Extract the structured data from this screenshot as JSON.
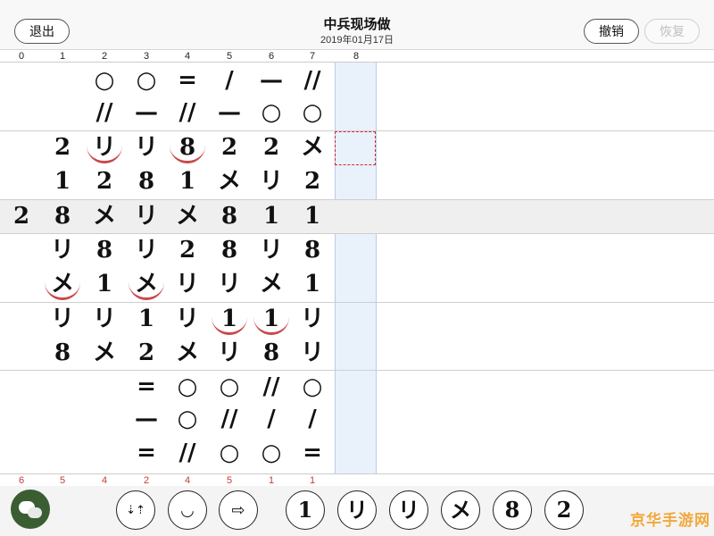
{
  "header": {
    "exit_label": "退出",
    "title": "中兵现场做",
    "date": "2019年01月17日",
    "undo_label": "撤销",
    "redo_label": "恢复"
  },
  "column_numbers": [
    "0",
    "1",
    "2",
    "3",
    "4",
    "5",
    "6",
    "7",
    "8"
  ],
  "grid": {
    "rows": [
      {
        "cells": [
          "",
          "",
          "○",
          "○",
          "=",
          "/",
          "—",
          "//"
        ]
      },
      {
        "cells": [
          "",
          "",
          "//",
          "—",
          "//",
          "—",
          "○",
          "○"
        ]
      },
      {
        "cells": [
          "",
          "2",
          "リ",
          "リ",
          "8",
          "2",
          "2",
          "メ"
        ]
      },
      {
        "cells": [
          "",
          "1",
          "2",
          "8",
          "1",
          "メ",
          "リ",
          "2"
        ]
      },
      {
        "cells": [
          "2",
          "8",
          "メ",
          "リ",
          "メ",
          "8",
          "1",
          "1"
        ]
      },
      {
        "cells": [
          "",
          "リ",
          "8",
          "リ",
          "2",
          "8",
          "リ",
          "8"
        ]
      },
      {
        "cells": [
          "",
          "メ",
          "1",
          "メ",
          "リ",
          "リ",
          "メ",
          "1"
        ]
      },
      {
        "cells": [
          "",
          "リ",
          "リ",
          "1",
          "リ",
          "1",
          "1",
          "リ"
        ]
      },
      {
        "cells": [
          "",
          "8",
          "メ",
          "2",
          "メ",
          "リ",
          "8",
          "リ"
        ]
      },
      {
        "cells": [
          "",
          "",
          "",
          "=",
          "○",
          "○",
          "//",
          "○"
        ]
      },
      {
        "cells": [
          "",
          "",
          "",
          "—",
          "○",
          "//",
          "/",
          "/"
        ]
      },
      {
        "cells": [
          "",
          "",
          "",
          "=",
          "//",
          "○",
          "○",
          "="
        ]
      }
    ],
    "highlighted_row_index": 4,
    "selected_cell": {
      "row": 2,
      "col": 8
    }
  },
  "bottom_counts": [
    "6",
    "5",
    "4",
    "2",
    "4",
    "5",
    "1",
    "1"
  ],
  "toolbar": {
    "sort_icon": "sort-icon",
    "smile_symbol": "◡",
    "next_symbol": "⇨",
    "symbols": [
      "1",
      "リ",
      "リ",
      "メ",
      "8",
      "2"
    ]
  },
  "watermark": "京华手游网",
  "colors": {
    "accent_red": "#c9484a",
    "column_band": "#e9f1fb",
    "avatar_green": "#3a5e32",
    "watermark": "#f2a83a"
  }
}
